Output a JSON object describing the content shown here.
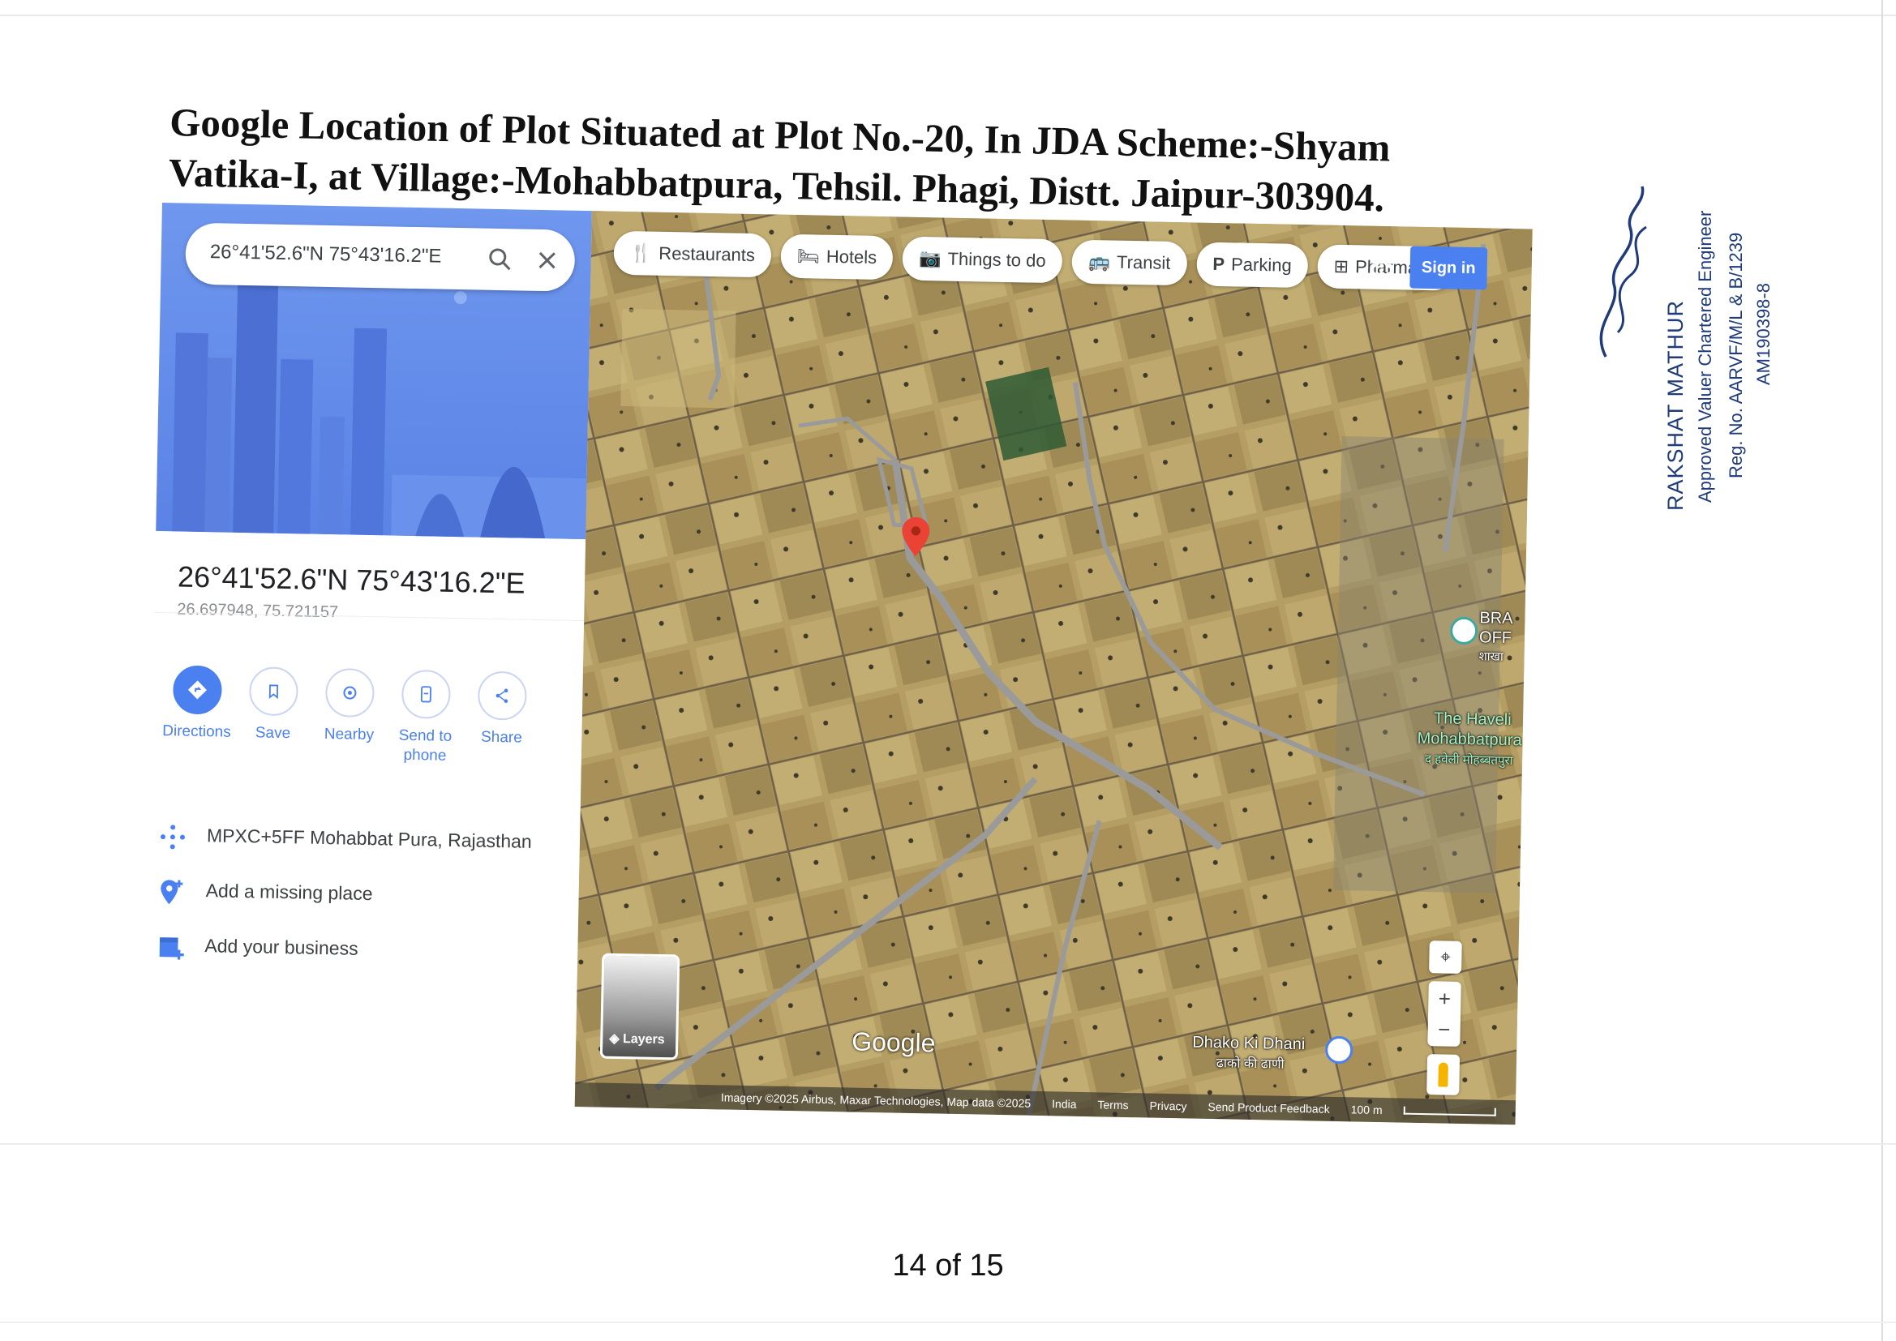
{
  "document": {
    "title": "Google Location of Plot Situated at Plot No.-20, In JDA Scheme:-Shyam Vatika-I, at Village:-Mohabbatpura, Tehsil. Phagi, Distt. Jaipur-303904.",
    "page_number": "14 of 15"
  },
  "maps_panel": {
    "search_value": "26°41'52.6\"N 75°43'16.2\"E",
    "place_title": "26°41'52.6\"N 75°43'16.2\"E",
    "decimal_coords": "26.697948, 75.721157",
    "actions": [
      {
        "label": "Directions",
        "icon": "directions-icon"
      },
      {
        "label": "Save",
        "icon": "bookmark-icon"
      },
      {
        "label": "Nearby",
        "icon": "nearby-icon"
      },
      {
        "label": "Send to phone",
        "icon": "phone-icon"
      },
      {
        "label": "Share",
        "icon": "share-icon"
      }
    ],
    "plus_code": "MPXC+5FF Mohabbat Pura, Rajasthan",
    "add_missing_place": "Add a missing place",
    "add_business": "Add your business"
  },
  "map": {
    "chips": [
      {
        "label": "Restaurants",
        "icon": "fork-knife-icon"
      },
      {
        "label": "Hotels",
        "icon": "bed-icon"
      },
      {
        "label": "Things to do",
        "icon": "camera-icon"
      },
      {
        "label": "Transit",
        "icon": "bus-icon"
      },
      {
        "label": "Parking",
        "icon": "parking-icon"
      },
      {
        "label": "Pharmac",
        "icon": "pharmacy-icon"
      }
    ],
    "sign_in": "Sign in",
    "labels": {
      "bra": "BRA",
      "off": "OFF",
      "branch_hindi": "शाखा",
      "haveli_line1": "The Haveli",
      "haveli_line2": "Mohabbatpura",
      "haveli_hindi": "द हवेली मोहब्बतपुरा",
      "dhani": "Dhako Ki Dhani",
      "dhani_hindi": "ढाको की ढाणी"
    },
    "layers_label": "Layers",
    "wordmark": "Google",
    "attribution": "Imagery ©2025 Airbus, Maxar Technologies, Map data ©2025",
    "footer_links": [
      "India",
      "Terms",
      "Privacy",
      "Send Product Feedback"
    ],
    "scale": "100 m",
    "colors": {
      "marker": "#ea4335",
      "accent": "#4a80ef",
      "road": "#9a9a9a",
      "field": "#b09a60"
    }
  },
  "signature_block": {
    "name": "RAKSHAT MATHUR",
    "role": "Approved Valuer Chartered Engineer",
    "reg_no": "Reg. No. AARVF/M/L & B/1239",
    "id": "AM190398-8"
  }
}
